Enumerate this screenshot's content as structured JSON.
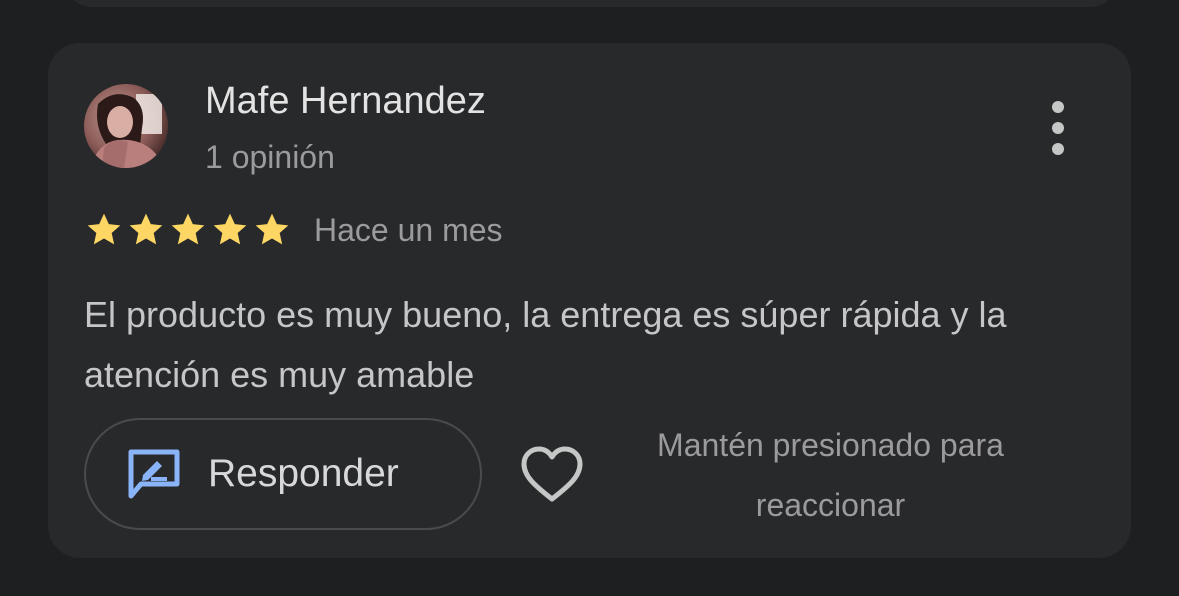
{
  "review": {
    "reviewer_name": "Mafe Hernandez",
    "reviewer_review_count": "1 opinión",
    "rating": 5,
    "rating_max": 5,
    "date": "Hace un mes",
    "text": "El producto es muy bueno, la entrega es súper rápida y la atención es muy amable",
    "more_icon": "more-vert-icon"
  },
  "actions": {
    "reply_label": "Responder",
    "reply_icon": "reply-edit-icon",
    "like_icon": "heart-outline-icon",
    "react_hint": "Mantén presionado para reaccionar"
  },
  "colors": {
    "page_background": "#1e1f20",
    "card_background": "#28292b",
    "star": "#fdd663",
    "reply_icon": "#8ab4f8",
    "primary_text": "#e3e3e3",
    "secondary_text": "#9b9b9e",
    "body_text": "#c6c6c9"
  }
}
